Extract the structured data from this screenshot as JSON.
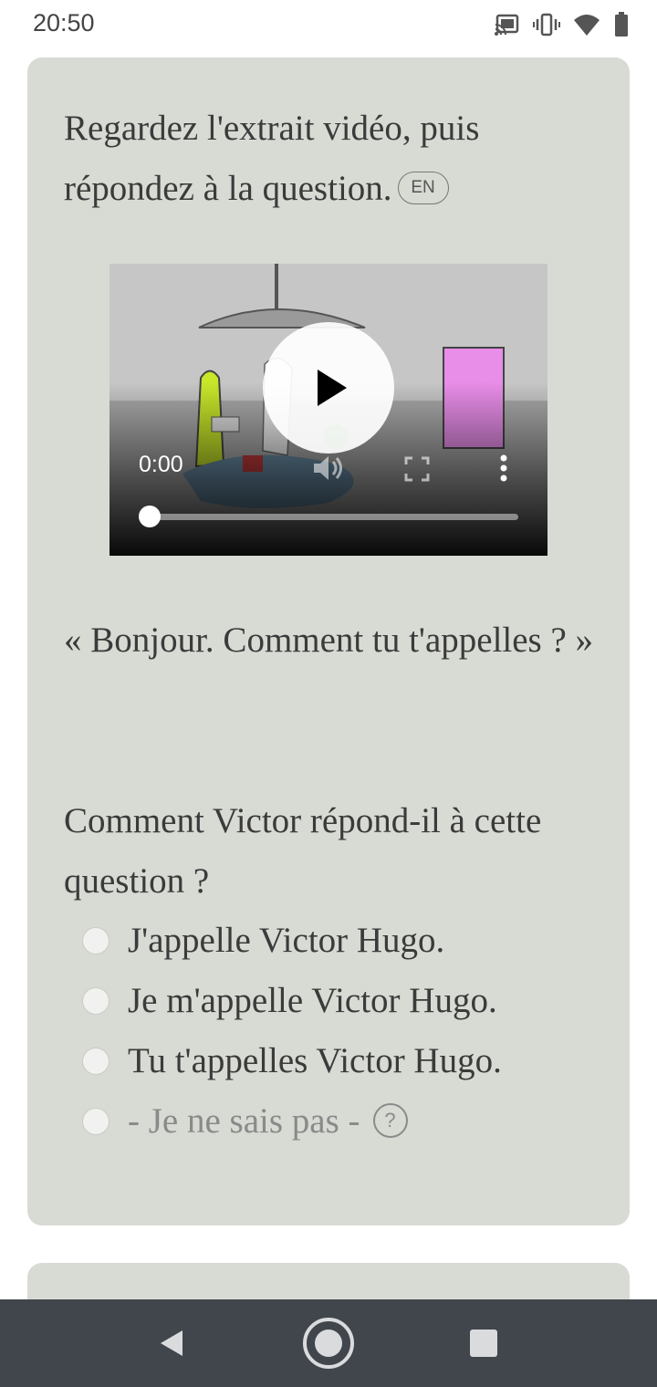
{
  "status_bar": {
    "time": "20:50",
    "icons": [
      "cast-icon",
      "vibrate-icon",
      "wifi-icon",
      "battery-icon"
    ]
  },
  "card": {
    "instruction": "Regardez l'extrait vidéo, puis répondez à la question.",
    "language_badge": "EN",
    "video": {
      "time": "0:00",
      "progress": 0
    },
    "quote": "« Bonjour. Comment tu t'appelles ? »",
    "question": "Comment Victor répond-il à cette question ?",
    "options": [
      {
        "label": "J'appelle Victor Hugo."
      },
      {
        "label": "Je m'appelle Victor Hugo."
      },
      {
        "label": "Tu t'appelles Victor Hugo."
      },
      {
        "label": "- Je ne sais pas -"
      }
    ],
    "help_label": "?"
  },
  "nav_bar": {
    "buttons": [
      "back-icon",
      "home-icon",
      "recents-icon"
    ]
  },
  "colors": {
    "card_bg": "#d8dbd4",
    "text": "#3b3b3b",
    "muted_text": "#8a8a8a",
    "nav_bg": "#41464c"
  }
}
